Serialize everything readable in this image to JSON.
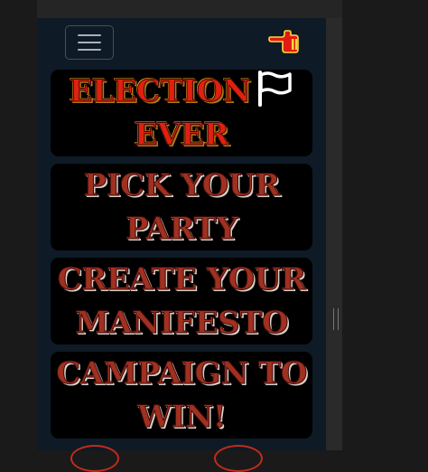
{
  "header": {
    "menu_icon": "hamburger-menu-icon",
    "hand_icon": "pointing-hand-icon"
  },
  "cards": [
    {
      "line1": "ELECTION",
      "line2": "EVER",
      "icon": "flag-icon"
    },
    {
      "line1": "PICK YOUR",
      "line2": "PARTY"
    },
    {
      "line1": "CREATE YOUR",
      "line2": "MANIFESTO"
    },
    {
      "line1": "CAMPAIGN TO",
      "line2": "WIN!"
    }
  ],
  "colors": {
    "panel_bg": "#0e1a26",
    "title_red": "#e02010",
    "card_text": "#a03020",
    "accent": "#c42a1c"
  }
}
